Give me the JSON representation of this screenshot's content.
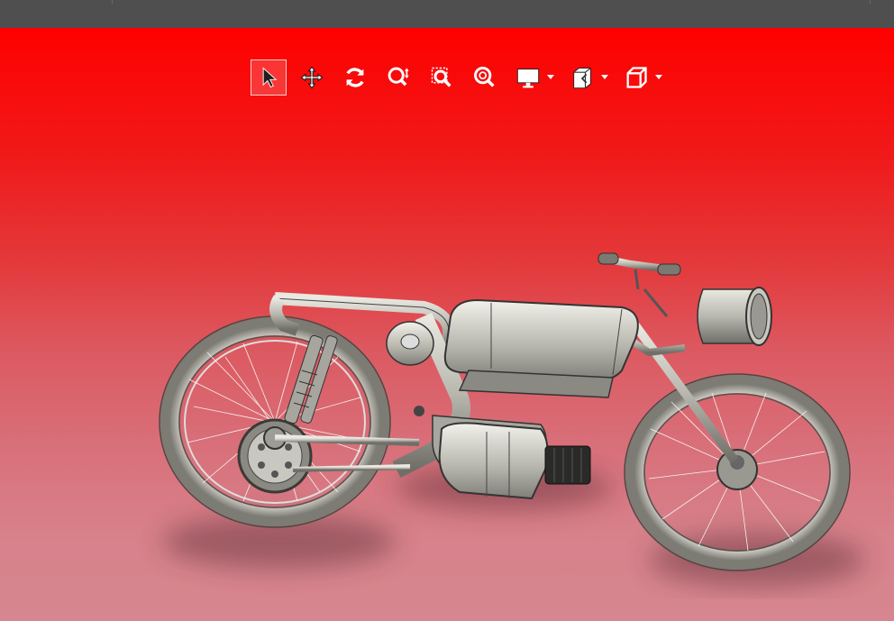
{
  "window": {
    "title": ""
  },
  "toolbar": {
    "tools": [
      {
        "id": "select",
        "icon": "select-arrow-icon",
        "active": true
      },
      {
        "id": "pan",
        "icon": "pan-move-icon",
        "active": false
      },
      {
        "id": "rotate",
        "icon": "rotate-icon",
        "active": false
      },
      {
        "id": "zoom-dynamic",
        "icon": "zoom-dynamic-icon",
        "active": false
      },
      {
        "id": "zoom-window",
        "icon": "zoom-window-icon",
        "active": false
      },
      {
        "id": "zoom-fit",
        "icon": "zoom-fit-icon",
        "active": false
      },
      {
        "id": "display-style",
        "icon": "display-monitor-icon",
        "has_dropdown": true
      },
      {
        "id": "section-view",
        "icon": "section-view-icon",
        "has_dropdown": true
      },
      {
        "id": "view-orientation",
        "icon": "view-cube-icon",
        "has_dropdown": true
      }
    ]
  },
  "viewport": {
    "model": "motorcycle-3d-model",
    "background_top": "#ff0000",
    "background_bottom": "#d6868f"
  }
}
